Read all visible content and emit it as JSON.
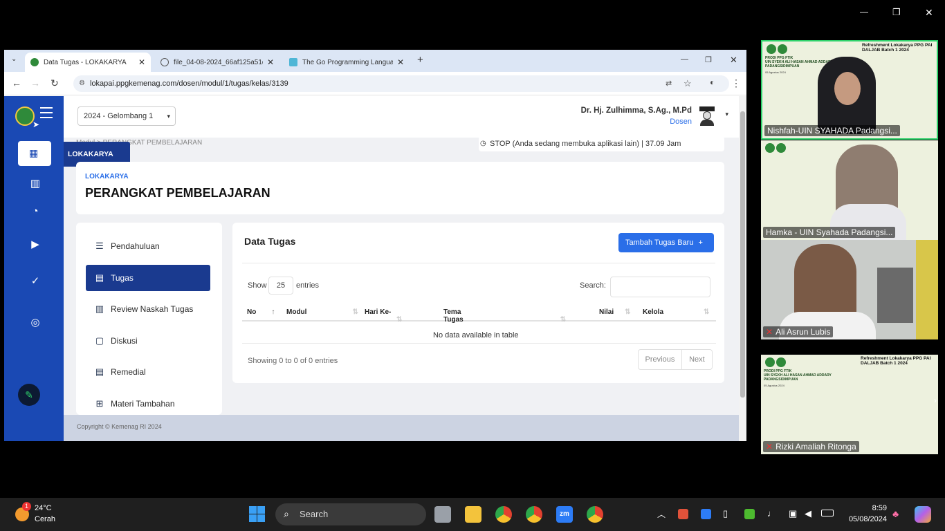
{
  "window": {
    "minimize": "—",
    "restore": "❐",
    "close": "✕"
  },
  "browser": {
    "tabs": [
      {
        "title": "Data Tugas - LOKAKARYA",
        "close": "✕"
      },
      {
        "title": "file_04-08-2024_66af125a51d1...",
        "close": "✕"
      },
      {
        "title": "The Go Programming Language",
        "close": "✕"
      }
    ],
    "new_tab": "+",
    "url": "lokapai.ppgkemenag.com/dosen/modul/1/tugas/kelas/3139",
    "controls": {
      "min": "—",
      "max": "❐",
      "close": "✕"
    }
  },
  "app": {
    "period_select": "2024 - Gelombang 1",
    "user_name": "Dr. Hj. Zulhimma, S.Ag., M.Pd",
    "user_role": "Dosen",
    "tooltip": "LOKAKARYA",
    "breadcrumb": "Modul > PERANGKAT PEMBELAJARAN",
    "timer": "STOP (Anda sedang membuka aplikasi lain) | 37.09 Jam",
    "header": {
      "overline": "LOKAKARYA",
      "title": "PERANGKAT PEMBELAJARAN"
    },
    "menu": [
      {
        "label": "Pendahuluan",
        "icon": "list-icon"
      },
      {
        "label": "Tugas",
        "icon": "assignment-icon"
      },
      {
        "label": "Review Naskah Tugas",
        "icon": "book-icon"
      },
      {
        "label": "Diskusi",
        "icon": "chat-icon"
      },
      {
        "label": "Remedial",
        "icon": "document-icon"
      },
      {
        "label": "Materi Tambahan",
        "icon": "file-plus-icon"
      }
    ],
    "data": {
      "title": "Data Tugas",
      "add_button": "Tambah Tugas Baru",
      "show_label": "Show",
      "entries_value": "25",
      "entries_label": "entries",
      "search_label": "Search:",
      "columns": [
        "No",
        "Modul",
        "Hari Ke-",
        "Tema Tugas",
        "Nilai",
        "Kelola"
      ],
      "empty": "No data available in table",
      "showing": "Showing 0 to 0 of 0 entries",
      "previous": "Previous",
      "next": "Next"
    },
    "footer": "Copyright © Kemenag RI 2024"
  },
  "zoom": {
    "participants": [
      {
        "name": "Nishfah-UIN SYAHADA Padangsi...",
        "muted": false
      },
      {
        "name": "Hamka - UIN Syahada Padangsi...",
        "muted": false
      },
      {
        "name": "Ali Asrun Lubis",
        "muted": true
      },
      {
        "name": "Rizki Amaliah Ritonga",
        "muted": true
      }
    ],
    "slide_title": "Refreshment Lokakarya PPG PAI\nDALJAB Batch 1 2024",
    "slide_org": "PRODI PPG FTIK\nUIN SYEKH ALI HASAN AHMAD ADDARY\nPADANGSIDIMPUAN",
    "slide_date": "05 Agustus 2024"
  },
  "taskbar": {
    "weather_temp": "24°C",
    "weather_desc": "Cerah",
    "weather_badge": "1",
    "search": "Search",
    "time": "8:59",
    "date": "05/08/2024"
  },
  "colors": {
    "sidebar": "#1a49b4",
    "primary": "#2a6ee8",
    "active_menu": "#1a3a8f",
    "zoom_border": "#2fd26b"
  }
}
